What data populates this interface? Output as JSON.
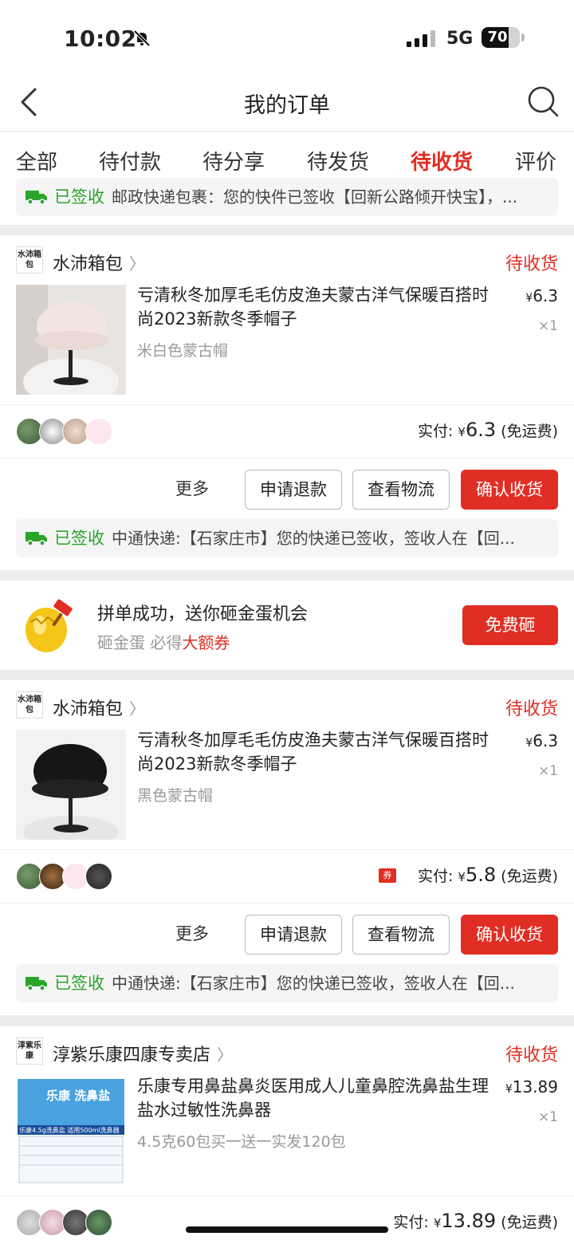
{
  "status_bar": {
    "time": "10:02",
    "network": "5G",
    "battery": "70",
    "battery_level": 0.7
  },
  "nav": {
    "title": "我的订单"
  },
  "tabs": [
    "全部",
    "待付款",
    "待分享",
    "待发货",
    "待收货",
    "评价"
  ],
  "active_tab": 4,
  "top_logistics": {
    "status": "已签收",
    "text": "邮政快递包裹：您的快件已签收【回新公路倾开快宝】，..."
  },
  "orders": [
    {
      "shop_logo": "水沛箱包",
      "shop_name": "水沛箱包",
      "status": "待收货",
      "product_name": "亏清秋冬加厚毛毛仿皮渔夫蒙古洋气保暖百搭时尚2023新款冬季帽子",
      "spec": "米白色蒙古帽",
      "price": "6.3",
      "currency": "¥",
      "qty": "×1",
      "paid_label": "实付:",
      "paid_amount": "6.3",
      "shipping": "(免运费)",
      "buttons": {
        "more": "更多",
        "refund": "申请退款",
        "logistics": "查看物流",
        "confirm": "确认收货"
      },
      "logistics": {
        "status": "已签收",
        "text": "中通快递:【石家庄市】您的快递已签收，签收人在【回..."
      }
    },
    {
      "shop_logo": "水沛箱包",
      "shop_name": "水沛箱包",
      "status": "待收货",
      "product_name": "亏清秋冬加厚毛毛仿皮渔夫蒙古洋气保暖百搭时尚2023新款冬季帽子",
      "spec": "黑色蒙古帽",
      "price": "6.3",
      "currency": "¥",
      "qty": "×1",
      "coupon": "券",
      "paid_label": "实付:",
      "paid_amount": "5.8",
      "shipping": "(免运费)",
      "buttons": {
        "more": "更多",
        "refund": "申请退款",
        "logistics": "查看物流",
        "confirm": "确认收货"
      },
      "logistics": {
        "status": "已签收",
        "text": "中通快递:【石家庄市】您的快递已签收，签收人在【回..."
      }
    },
    {
      "shop_logo": "淳紫乐康",
      "shop_name": "淳紫乐康四康专卖店",
      "status": "待收货",
      "product_name": "乐康专用鼻盐鼻炎医用成人儿童鼻腔洗鼻盐生理盐水过敏性洗鼻器",
      "spec": "4.5克60包买一送一实发120包",
      "price": "13.89",
      "currency": "¥",
      "qty": "×1",
      "paid_label": "实付:",
      "paid_amount": "13.89",
      "shipping": "(免运费)",
      "package_text": {
        "brand": "乐康 洗鼻盐",
        "band": "乐康4.5g洗鼻盐 适用500ml洗鼻器"
      }
    }
  ],
  "promo": {
    "title": "拼单成功，送你砸金蛋机会",
    "sub_prefix": "砸金蛋 必得",
    "sub_highlight": "大额券",
    "button": "免费砸"
  }
}
